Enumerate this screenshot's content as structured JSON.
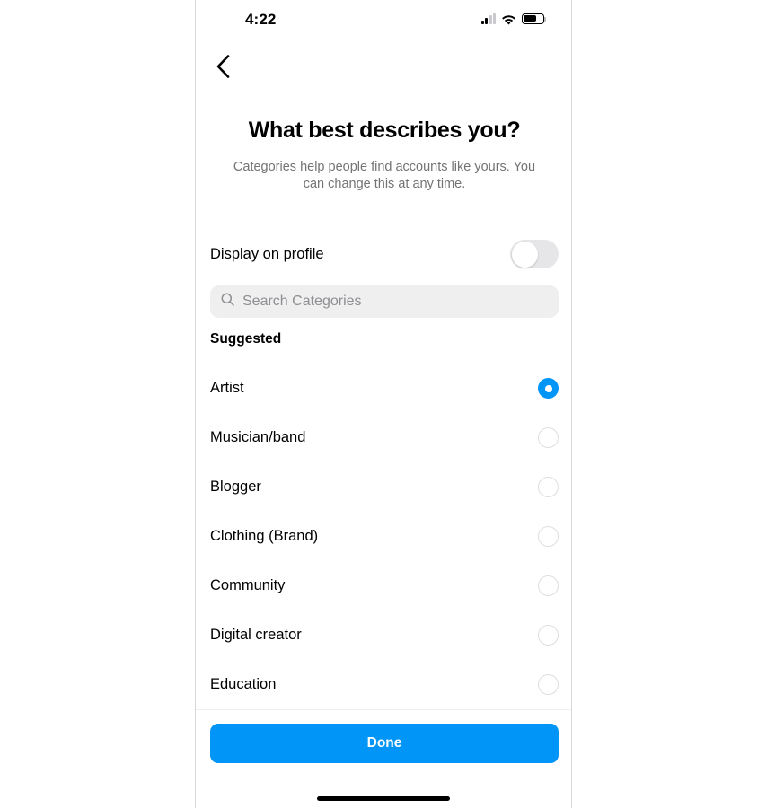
{
  "status_bar": {
    "time": "4:22",
    "signal_icon": "cellular-bars-icon",
    "wifi_icon": "wifi-icon",
    "battery_icon": "battery-icon",
    "signal_bars_filled": 2,
    "signal_bars_total": 4,
    "battery_level_percent": 65
  },
  "nav": {
    "back_icon": "chevron-left-icon"
  },
  "header": {
    "title": "What best describes you?",
    "subtitle": "Categories help people find accounts like yours. You can change this at any time."
  },
  "display_toggle": {
    "label": "Display on profile",
    "enabled": false
  },
  "search": {
    "placeholder": "Search Categories",
    "value": "",
    "icon": "search-icon"
  },
  "list": {
    "section_title": "Suggested",
    "items": [
      {
        "label": "Artist",
        "selected": true
      },
      {
        "label": "Musician/band",
        "selected": false
      },
      {
        "label": "Blogger",
        "selected": false
      },
      {
        "label": "Clothing (Brand)",
        "selected": false
      },
      {
        "label": "Community",
        "selected": false
      },
      {
        "label": "Digital creator",
        "selected": false
      },
      {
        "label": "Education",
        "selected": false
      }
    ]
  },
  "footer": {
    "done_label": "Done"
  },
  "colors": {
    "accent": "#0095f6",
    "search_bg": "#efefef",
    "toggle_track_off": "#e6e6e8",
    "radio_border": "#dedede",
    "subtitle_text": "#737373",
    "placeholder_text": "#8e8e93"
  }
}
